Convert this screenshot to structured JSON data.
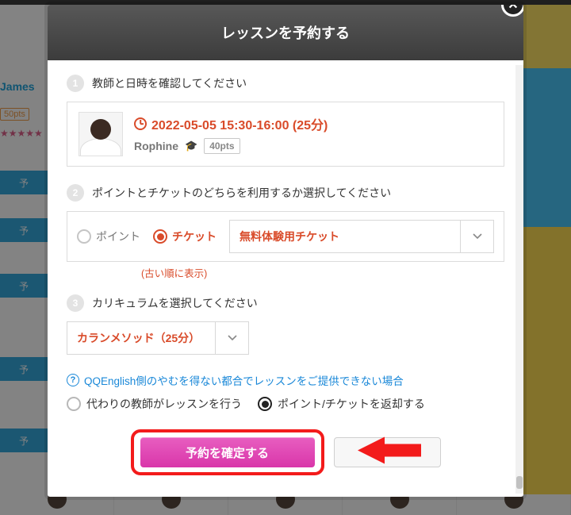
{
  "background": {
    "tutor_name_left": "James",
    "tutor_pts_left": "50pts",
    "stars": "★★★★★",
    "side_btn_label": "予"
  },
  "modal": {
    "title": "レッスンを予約する",
    "close_glyph": "✕"
  },
  "step1": {
    "num": "1",
    "label": "教師と日時を確認してください",
    "datetime": "2022-05-05 15:30-16:00 (25分)",
    "teacher_name": "Rophine",
    "grad_icon": "🎓",
    "pts_badge": "40pts"
  },
  "step2": {
    "num": "2",
    "label": "ポイントとチケットのどちらを利用するか選択してください",
    "radio_point": "ポイント",
    "radio_ticket": "チケット",
    "ticket_select_value": "無料体験用チケット",
    "hint": "(古い順に表示)"
  },
  "step3": {
    "num": "3",
    "label": "カリキュラムを選択してください",
    "curriculum_value": "カランメソッド（25分）"
  },
  "policy": {
    "help_text": "QQEnglish側のやむを得ない都合でレッスンをご提供できない場合",
    "opt_substitute": "代わりの教師がレッスンを行う",
    "opt_refund": "ポイント/チケットを返却する"
  },
  "actions": {
    "confirm": "予約を確定する"
  }
}
